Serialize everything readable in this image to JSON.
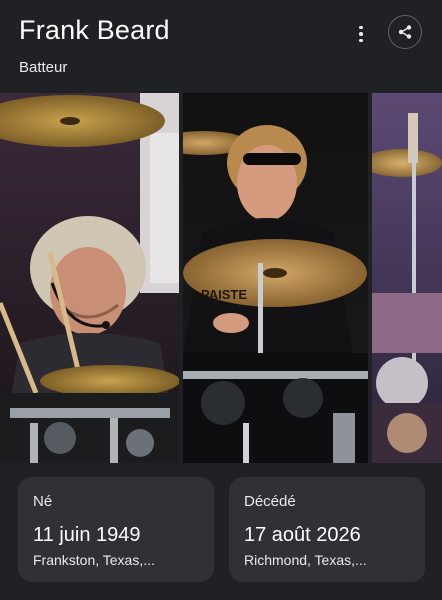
{
  "header": {
    "title": "Frank Beard",
    "subtitle": "Batteur"
  },
  "icons": {
    "menu": "more-vert-icon",
    "share": "share-icon"
  },
  "gallery": {
    "photos": [
      {
        "depicts": "drummer-with-headset-mic-photo"
      },
      {
        "depicts": "drummer-with-sunglasses-paiste-cymbal-photo"
      },
      {
        "depicts": "drum-kit-closeup-photo"
      }
    ],
    "cymbal_brand": "PAISTE"
  },
  "facts": [
    {
      "label": "Né",
      "value": "11 juin 1949",
      "detail": "Frankston, Texas,..."
    },
    {
      "label": "Décédé",
      "value": "17 août 2026",
      "detail": "Richmond, Texas,..."
    }
  ]
}
